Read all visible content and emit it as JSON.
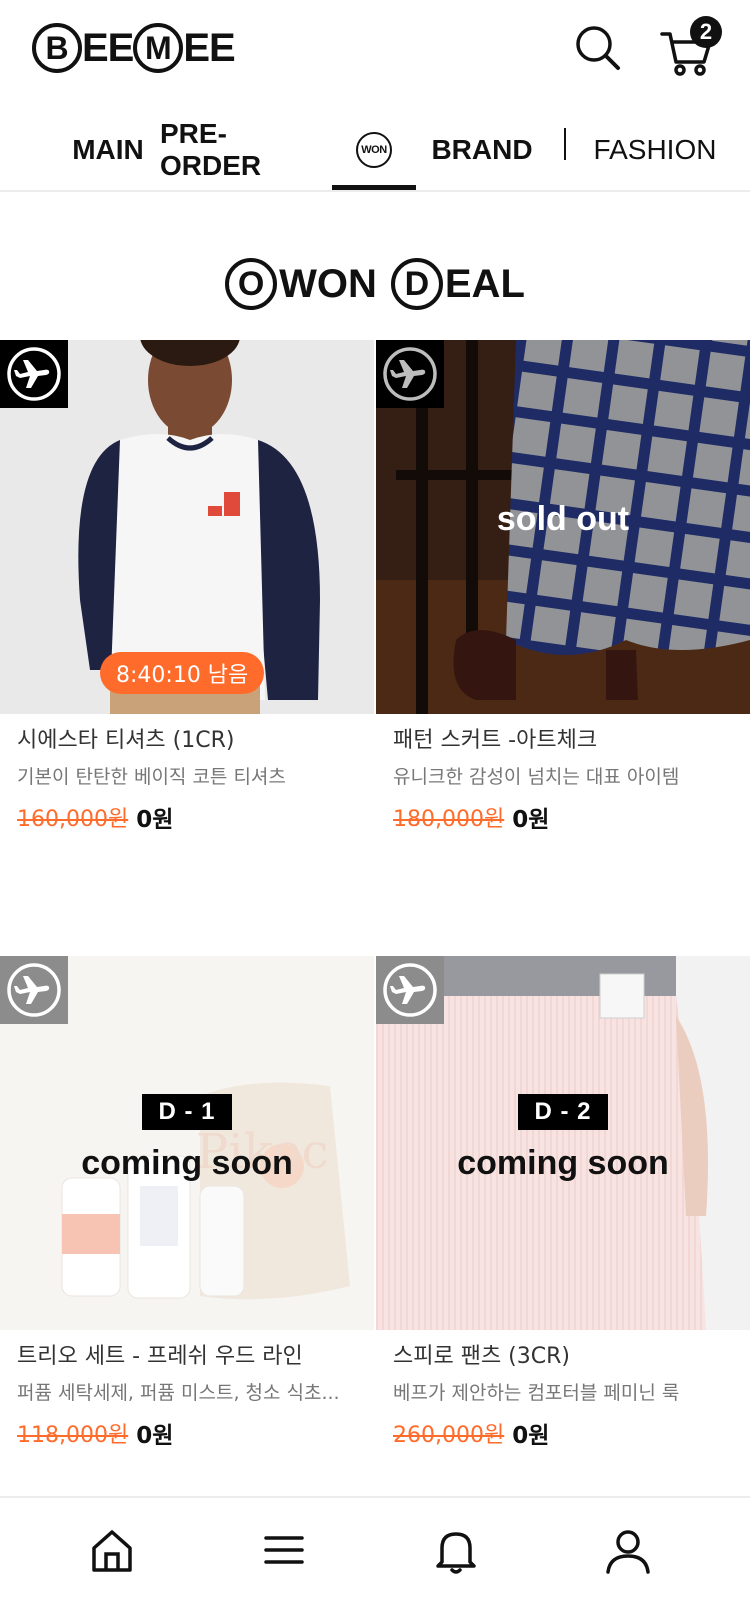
{
  "header": {
    "logo": {
      "part1": "B",
      "part2": "EE",
      "part3": "M",
      "part4": "EE"
    },
    "cart_count": "2"
  },
  "nav": {
    "items": [
      {
        "label": "MAIN"
      },
      {
        "label": "PRE-ORDER"
      },
      {
        "label": "WON"
      },
      {
        "label": "BRAND"
      },
      {
        "label": "FASHION"
      }
    ],
    "active": "WON"
  },
  "section": {
    "title_initial1": "O",
    "title_rest1": "WON",
    "title_initial2": "D",
    "title_rest2": "EAL"
  },
  "products": [
    {
      "name": "시에스타 티셔츠 (1CR)",
      "desc": "기본이 탄탄한 베이직 코튼 티셔츠",
      "original_price": "160,000원",
      "sale_price": "0원",
      "timer": "8:40:10 남음",
      "badge_icon": "airplane-icon"
    },
    {
      "name": "패턴 스커트 -아트체크",
      "desc": "유니크한 감성이 넘치는 대표 아이템",
      "original_price": "180,000원",
      "sale_price": "0원",
      "overlay": "sold out",
      "badge_icon": "airplane-icon"
    },
    {
      "name": "트리오 세트 - 프레쉬 우드 라인",
      "desc": "퍼퓸 세탁세제, 퍼퓸 미스트, 청소 식초...",
      "original_price": "118,000원",
      "sale_price": "0원",
      "d_day": "D - 1",
      "overlay": "coming soon",
      "image_text": "Pikoc",
      "badge_icon": "airplane-icon"
    },
    {
      "name": "스피로 팬츠 (3CR)",
      "desc": "베프가 제안하는 컴포터블 페미닌 룩",
      "original_price": "260,000원",
      "sale_price": "0원",
      "d_day": "D - 2",
      "overlay": "coming soon",
      "badge_icon": "airplane-icon"
    }
  ],
  "bottom_nav": {
    "icons": [
      "home-icon",
      "menu-icon",
      "bell-icon",
      "user-icon"
    ]
  },
  "colors": {
    "accent_orange": "#ff6b2b",
    "text_dark": "#111111",
    "text_gray": "#777777"
  }
}
